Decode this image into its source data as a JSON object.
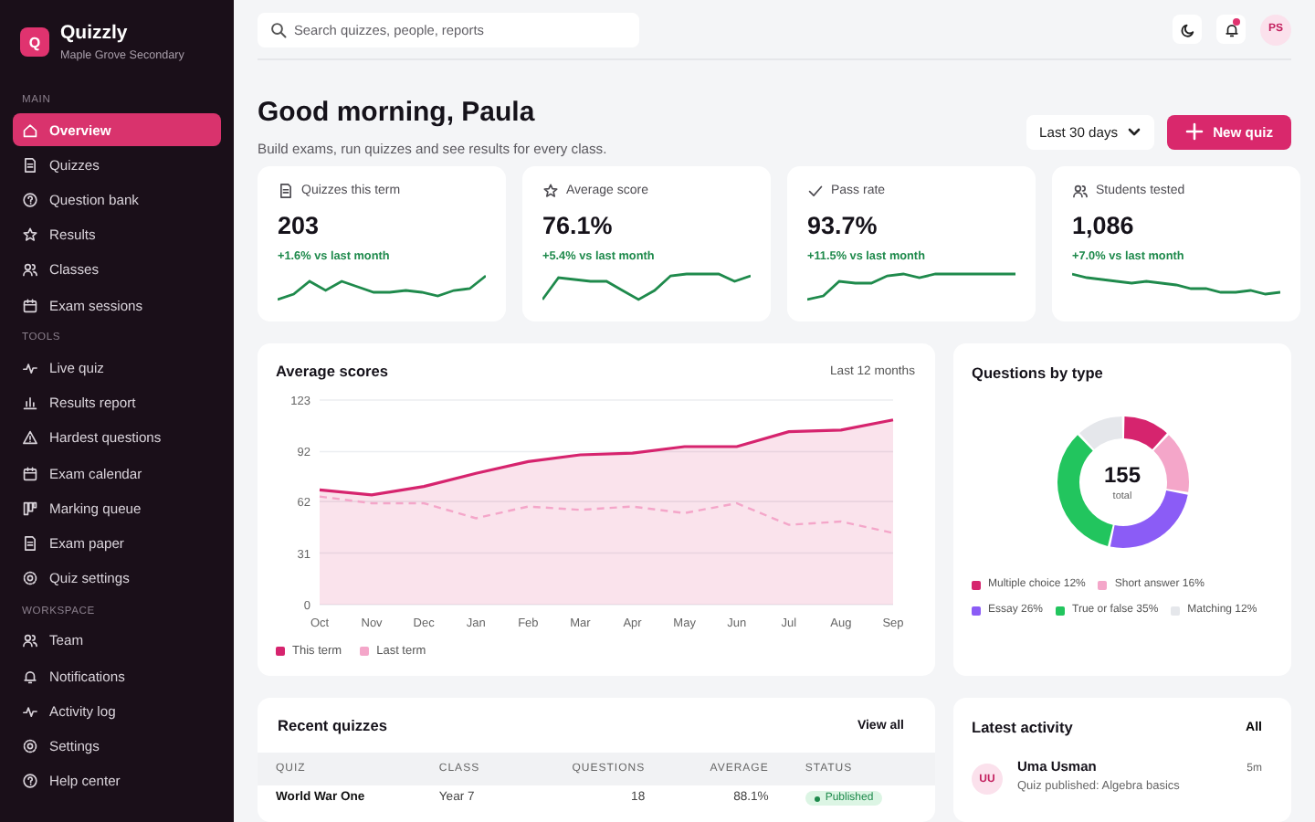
{
  "sidebar": {
    "brand": {
      "logo": "Q",
      "name": "Quizzly",
      "subtitle": "Maple Grove Secondary"
    },
    "sections": [
      {
        "label": "MAIN",
        "items": [
          {
            "label": "Overview",
            "selected": true
          },
          {
            "label": "Quizzes",
            "selected": false
          },
          {
            "label": "Question bank",
            "selected": false
          },
          {
            "label": "Results",
            "selected": false
          },
          {
            "label": "Classes",
            "selected": false
          },
          {
            "label": "Exam sessions",
            "selected": false
          }
        ]
      },
      {
        "label": "TOOLS",
        "items": [
          {
            "label": "Live quiz",
            "selected": false
          },
          {
            "label": "Results report",
            "selected": false
          },
          {
            "label": "Hardest questions",
            "selected": false
          },
          {
            "label": "Exam calendar",
            "selected": false
          },
          {
            "label": "Marking queue",
            "selected": false
          },
          {
            "label": "Exam paper",
            "selected": false
          },
          {
            "label": "Quiz settings",
            "selected": false
          }
        ]
      },
      {
        "label": "WORKSPACE",
        "items": [
          {
            "label": "Team",
            "selected": false
          },
          {
            "label": "Notifications",
            "selected": false
          },
          {
            "label": "Activity log",
            "selected": false
          },
          {
            "label": "Settings",
            "selected": false
          },
          {
            "label": "Help center",
            "selected": false
          }
        ]
      }
    ]
  },
  "topbar": {
    "search": {
      "placeholder": "Search quizzes, people, reports"
    },
    "notifications_unread": true,
    "avatar": "PS"
  },
  "header": {
    "title": "Good morning, Paula",
    "subtitle": "Build exams, run quizzes and see results for every class.",
    "range": "Last 30 days",
    "new_button": "New quiz"
  },
  "stats": [
    {
      "label": "Quizzes this term",
      "value": "203",
      "change": "+1.6% vs last month"
    },
    {
      "label": "Average score",
      "value": "76.1%",
      "change": "+5.4% vs last month"
    },
    {
      "label": "Pass rate",
      "value": "93.7%",
      "change": "+11.5% vs last month"
    },
    {
      "label": "Students tested",
      "value": "1,086",
      "change": "+7.0% vs last month"
    }
  ],
  "scores_card": {
    "title": "Average scores",
    "period": "Last 12 months",
    "chart_data": {
      "type": "line",
      "categories": [
        "Oct",
        "Nov",
        "Dec",
        "Jan",
        "Feb",
        "Mar",
        "Apr",
        "May",
        "Jun",
        "Jul",
        "Aug",
        "Sep"
      ],
      "ylim": [
        0,
        123
      ],
      "grid": true,
      "yticks": [
        0,
        31,
        62,
        92,
        123
      ],
      "series": [
        {
          "name": "This term",
          "type": "area",
          "color": "#d6246e",
          "values": [
            69,
            66,
            71,
            79,
            86,
            90,
            91,
            95,
            95,
            104,
            105,
            111
          ]
        },
        {
          "name": "Last term",
          "type": "line",
          "line_style": "dashed",
          "color": "#f4a6c9",
          "values": [
            65,
            61,
            61,
            52,
            59,
            57,
            59,
            55,
            61,
            48,
            50,
            43
          ]
        }
      ]
    }
  },
  "types_card": {
    "title": "Questions by type",
    "total": "155",
    "total_label": "total",
    "chart_data": {
      "type": "donut",
      "categories": [
        "Multiple choice 12%",
        "Short answer 16%",
        "Essay 26%",
        "True or false 35%",
        "Matching 12%"
      ],
      "values": [
        12,
        16,
        26,
        35,
        12
      ],
      "colors": [
        "#d6246e",
        "#f4a6c9",
        "#8b5cf6",
        "#22c55e",
        "#e5e7eb"
      ]
    }
  },
  "recent": {
    "title": "Recent quizzes",
    "link": "View all",
    "columns": [
      "QUIZ",
      "CLASS",
      "QUESTIONS",
      "AVERAGE",
      "STATUS"
    ],
    "rows": [
      {
        "cells": [
          "World War One",
          "Year 7",
          "18",
          "88.1%"
        ],
        "status": "Published"
      }
    ]
  },
  "activity": {
    "title": "Latest activity",
    "filter": "All",
    "items": [
      {
        "initials": "UU",
        "name": "Uma Usman",
        "text": "Quiz published: Algebra basics",
        "time": "5m"
      }
    ]
  }
}
